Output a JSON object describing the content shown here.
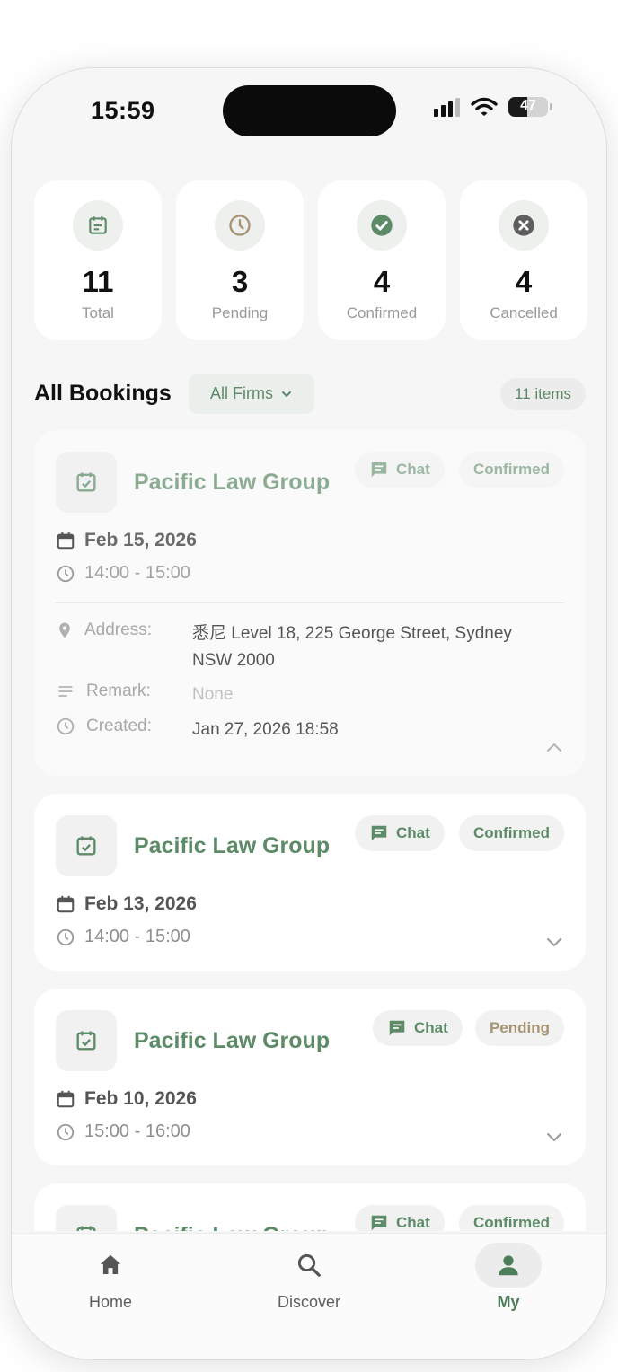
{
  "status_bar": {
    "time": "15:59",
    "battery": "47"
  },
  "stats": [
    {
      "value": "11",
      "label": "Total",
      "icon": "calendar-icon"
    },
    {
      "value": "3",
      "label": "Pending",
      "icon": "clock-icon"
    },
    {
      "value": "4",
      "label": "Confirmed",
      "icon": "check-circle-icon"
    },
    {
      "value": "4",
      "label": "Cancelled",
      "icon": "x-circle-icon"
    }
  ],
  "section": {
    "title": "All Bookings",
    "filter": "All Firms",
    "count": "11 items"
  },
  "bookings": [
    {
      "firm": "Pacific Law Group",
      "chat": "Chat",
      "status": "Confirmed",
      "date": "Feb 15, 2026",
      "time": "14:00 - 15:00",
      "address_label": "Address:",
      "address": "悉尼 Level 18, 225 George Street, Sydney NSW 2000",
      "remark_label": "Remark:",
      "remark": "None",
      "created_label": "Created:",
      "created": "Jan 27, 2026 18:58"
    },
    {
      "firm": "Pacific Law Group",
      "chat": "Chat",
      "status": "Confirmed",
      "date": "Feb 13, 2026",
      "time": "14:00 - 15:00"
    },
    {
      "firm": "Pacific Law Group",
      "chat": "Chat",
      "status": "Pending",
      "date": "Feb 10, 2026",
      "time": "15:00 - 16:00"
    },
    {
      "firm": "Pacific Law Group",
      "chat": "Chat",
      "status": "Confirmed"
    }
  ],
  "tabs": [
    {
      "label": "Home",
      "icon": "home-icon"
    },
    {
      "label": "Discover",
      "icon": "search-icon"
    },
    {
      "label": "My",
      "icon": "person-icon",
      "active": true
    }
  ],
  "colors": {
    "accent": "#5d8b68",
    "pending": "#a79474",
    "background": "#f6f6f6"
  }
}
